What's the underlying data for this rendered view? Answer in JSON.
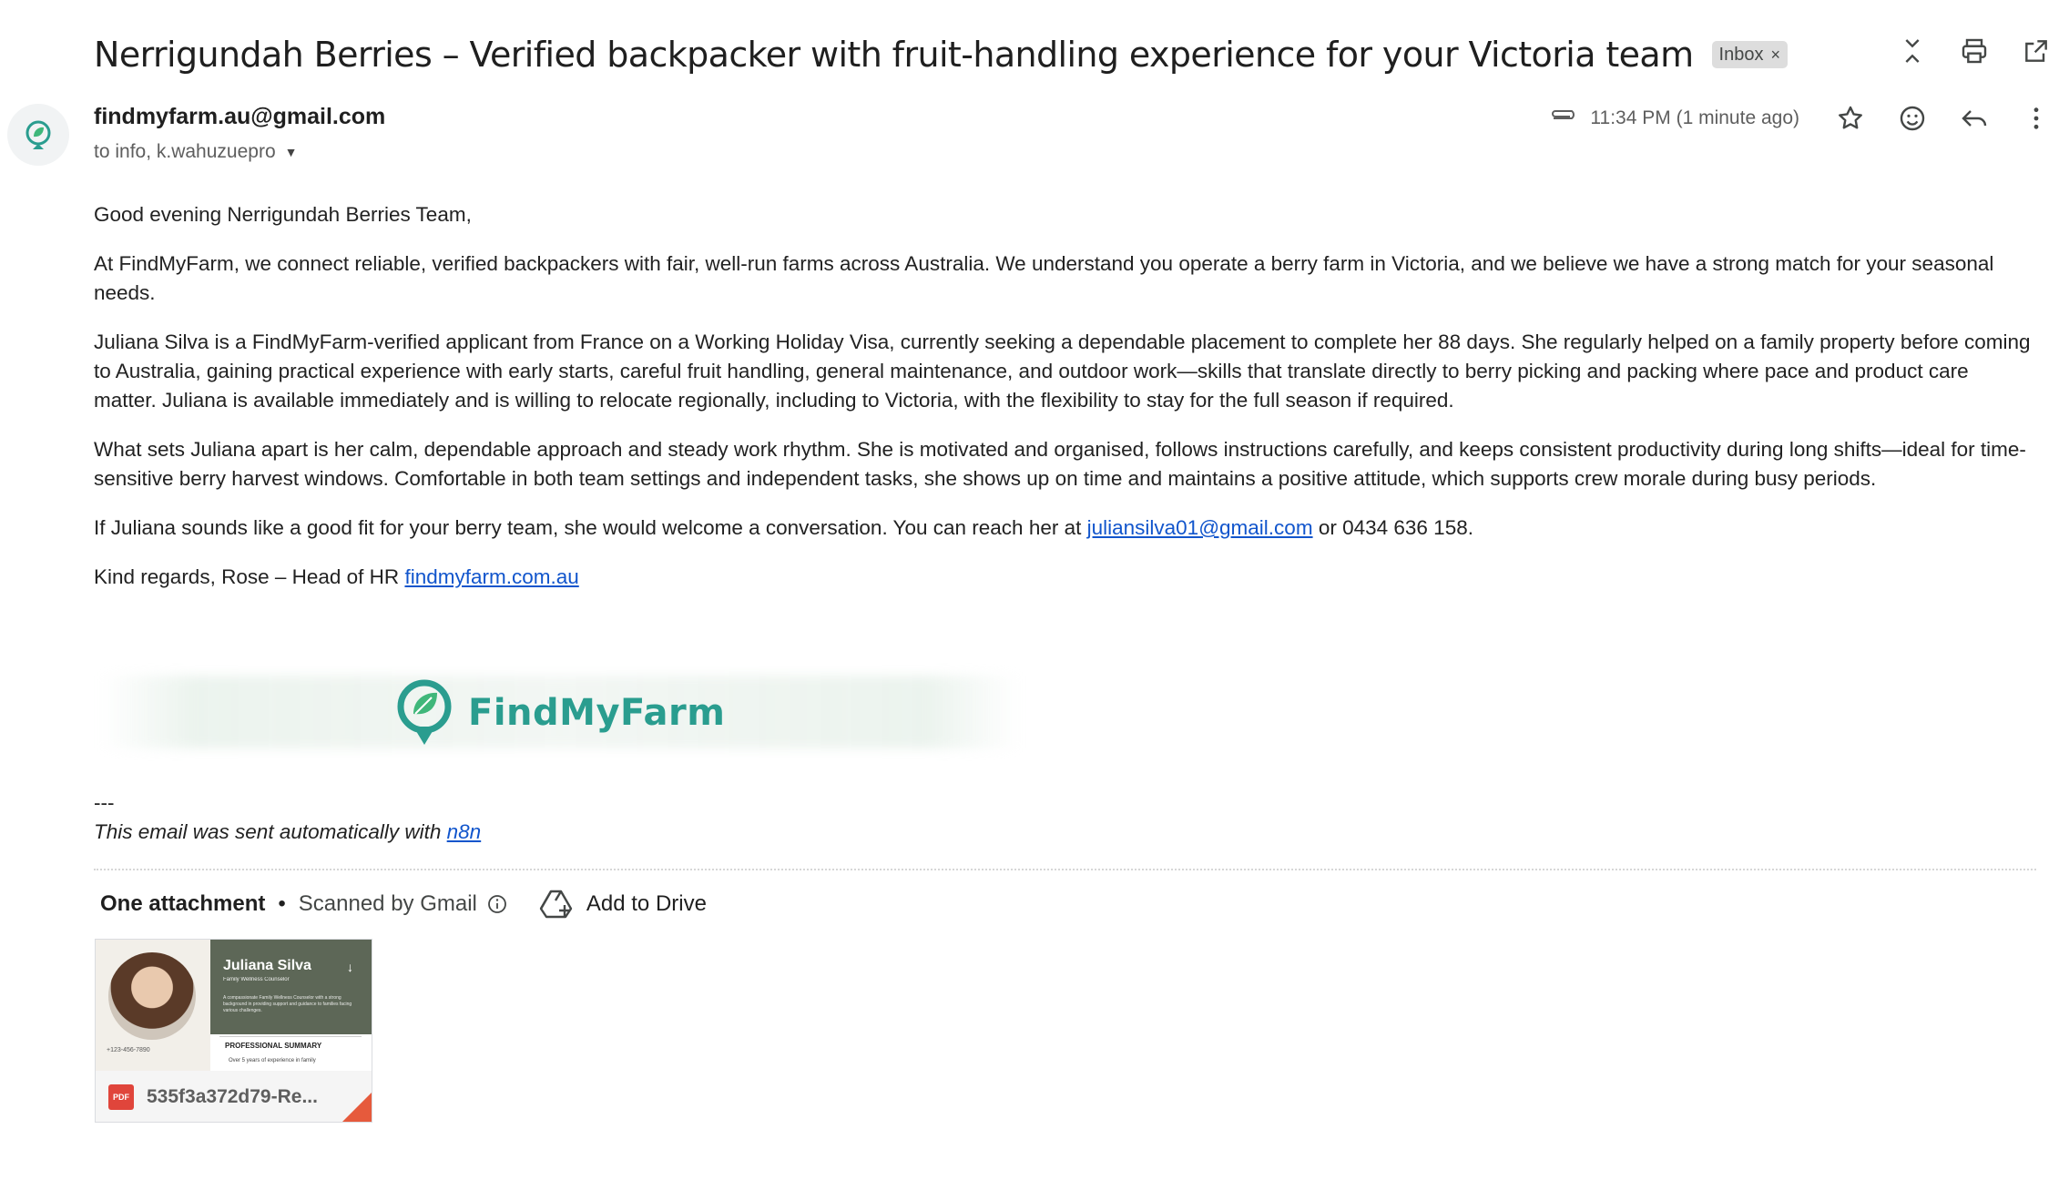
{
  "email": {
    "subject": "Nerrigundah Berries – Verified backpacker with fruit-handling experience for your Victoria team",
    "label": "Inbox",
    "label_remove": "×",
    "sender_email": "findmyfarm.au@gmail.com",
    "recipients": "to info, k.wahuzuepro",
    "timestamp": "11:34 PM (1 minute ago)"
  },
  "top_actions": [
    "collapse-icon",
    "print-icon",
    "open-in-new-window-icon"
  ],
  "message_actions": [
    "star-icon",
    "emoji-reaction-icon",
    "reply-icon",
    "more-vertical-icon"
  ],
  "body": {
    "greeting": "Good evening Nerrigundah Berries Team,",
    "para1": "At FindMyFarm, we connect reliable, verified backpackers with fair, well-run farms across Australia. We understand you operate a berry farm in Victoria, and we believe we have a strong match for your seasonal needs.",
    "para2": "Juliana Silva is a FindMyFarm-verified applicant from France on a Working Holiday Visa, currently seeking a dependable placement to complete her 88 days. She regularly helped on a family property before coming to Australia, gaining practical experience with early starts, careful fruit handling, general maintenance, and outdoor work—skills that translate directly to berry picking and packing where pace and product care matter. Juliana is available immediately and is willing to relocate regionally, including to Victoria, with the flexibility to stay for the full season if required.",
    "para3": "What sets Juliana apart is her calm, dependable approach and steady work rhythm. She is motivated and organised, follows instructions carefully, and keeps consistent productivity during long shifts—ideal for time-sensitive berry harvest windows. Comfortable in both team settings and independent tasks, she shows up on time and maintains a positive attitude, which supports crew morale during busy periods.",
    "para4_prefix": "If Juliana sounds like a good fit for your berry team, she would welcome a conversation. You can reach her at ",
    "para4_email": "juliansilva01@gmail.com",
    "para4_suffix": " or 0434 636 158.",
    "closing_prefix": "Kind regards, Rose – Head of HR ",
    "closing_link": "findmyfarm.com.au"
  },
  "logo": {
    "text": "FindMyFarm",
    "color": "#2a9d8f"
  },
  "signature": {
    "separator": "---",
    "auto_prefix": "This email was sent automatically with ",
    "auto_link": "n8n"
  },
  "attachments": {
    "title": "One attachment",
    "dot": "•",
    "scanned": "Scanned by Gmail",
    "add_to_drive": "Add to Drive",
    "file_name": "535f3a372d79-Re...",
    "file_type": "PDF",
    "thumb": {
      "name": "Juliana Silva",
      "role": "Family Wellness Counselor",
      "desc": "A compassionate Family Wellness Counselor with a strong background in providing support and guidance to families facing various challenges.",
      "phone": "+123-456-7890",
      "summary": "PROFESSIONAL SUMMARY",
      "bullet": "Over 5 years of experience in family",
      "download": "↓"
    }
  }
}
